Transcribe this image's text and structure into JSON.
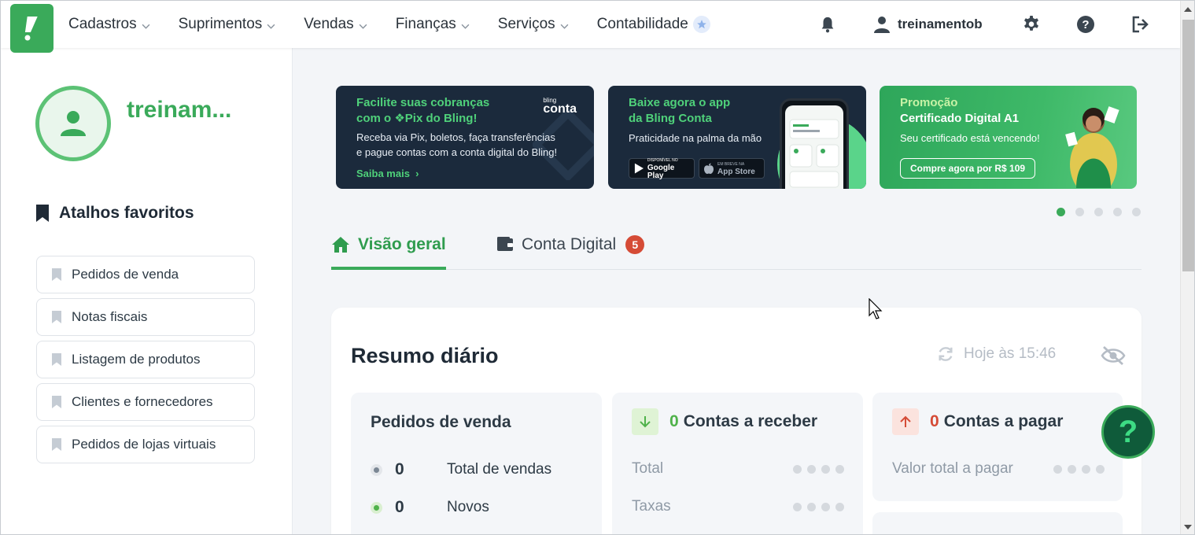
{
  "nav": {
    "menu": [
      "Cadastros",
      "Suprimentos",
      "Vendas",
      "Finanças",
      "Serviços",
      "Contabilidade"
    ],
    "username": "treinamentob",
    "icons": [
      "bell-icon",
      "user-icon",
      "gear-icon",
      "help-circle-icon",
      "logout-icon"
    ],
    "brand_color": "#3aaa5a"
  },
  "sidebar": {
    "profile_name": "treinam...",
    "favorites_title": "Atalhos favoritos",
    "favorites": [
      "Pedidos de venda",
      "Notas fiscais",
      "Listagem de produtos",
      "Clientes e fornecedores",
      "Pedidos de lojas virtuais"
    ]
  },
  "banners": {
    "pix": {
      "title_line1": "Facilite suas cobranças",
      "title_line2": "com o ❖Pix do Bling!",
      "text_line1": "Receba via Pix, boletos, faça transferências",
      "text_line2": "e pague contas com a conta digital do Bling!",
      "link": "Saiba mais",
      "brand_small": "bling",
      "brand": "conta"
    },
    "app": {
      "title_line1": "Baixe agora o app",
      "title_line2": "da Bling Conta",
      "text": "Praticidade na palma da mão",
      "google_small": "DISPONÍVEL NO",
      "google": "Google Play",
      "apple_small": "EM BREVE NA",
      "apple": "App Store"
    },
    "promo": {
      "title_line1": "Promoção",
      "title_line2": "Certificado Digital A1",
      "text": "Seu certificado está vencendo!",
      "button": "Compre agora por R$ 109"
    },
    "carousel_count": 5,
    "carousel_active": 0
  },
  "tabs": {
    "overview": "Visão geral",
    "digital": "Conta Digital",
    "digital_badge": "5"
  },
  "summary": {
    "title": "Resumo diário",
    "updated": "Hoje às 15:46",
    "sales": {
      "title": "Pedidos de venda",
      "rows": [
        {
          "value": "0",
          "label": "Total de vendas"
        },
        {
          "value": "0",
          "label": "Novos"
        }
      ]
    },
    "receivable": {
      "count": "0",
      "title": "Contas a receber",
      "rows": [
        "Total",
        "Taxas"
      ]
    },
    "payable": {
      "count": "0",
      "title": "Contas a pagar",
      "rows": [
        "Valor total a pagar"
      ]
    }
  },
  "help_fab": "?"
}
